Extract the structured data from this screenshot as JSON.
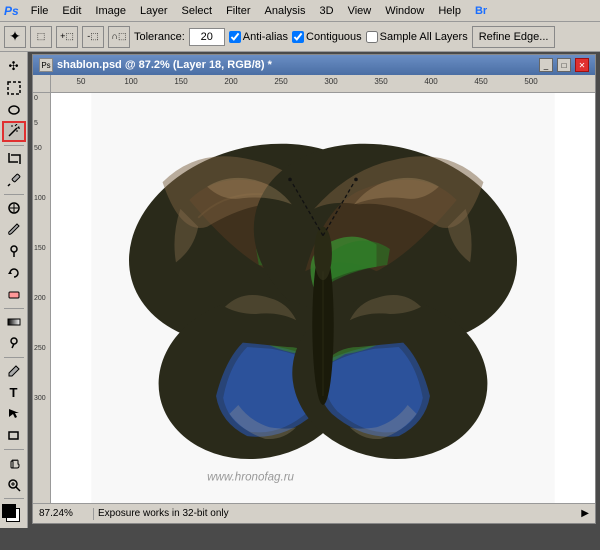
{
  "menubar": {
    "logo": "Ps",
    "items": [
      "File",
      "Edit",
      "Image",
      "Layer",
      "Select",
      "Filter",
      "Analysis",
      "3D",
      "View",
      "Window",
      "Help",
      "Br"
    ]
  },
  "optionsbar": {
    "tolerance_label": "Tolerance:",
    "tolerance_value": "20",
    "antialias_label": "Anti-alias",
    "contiguous_label": "Contiguous",
    "sampleall_label": "Sample All Layers",
    "antialias_checked": true,
    "contiguous_checked": true,
    "sampleall_checked": false,
    "refine_label": "Refine Edge..."
  },
  "document": {
    "icon": "Ps",
    "title": "shablon.psd @ 87.2% (Layer 18, RGB/8) *"
  },
  "ruler": {
    "h_marks": [
      50,
      100,
      150,
      200,
      250,
      300,
      350,
      400,
      450,
      500
    ],
    "v_marks": [
      0,
      5,
      50,
      100,
      150,
      200,
      250,
      300
    ]
  },
  "statusbar": {
    "zoom": "87.24%",
    "status_text": "Exposure works in 32-bit only"
  },
  "watermark": {
    "text": "www.hronofag.ru"
  },
  "tools": [
    {
      "name": "move",
      "icon": "✣",
      "active": false
    },
    {
      "name": "rectangular-marquee",
      "icon": "⬚",
      "active": false
    },
    {
      "name": "lasso",
      "icon": "⌾",
      "active": false
    },
    {
      "name": "magic-wand",
      "icon": "✦",
      "active": true,
      "highlighted": true
    },
    {
      "name": "crop",
      "icon": "✂",
      "active": false
    },
    {
      "name": "eyedropper",
      "icon": "⊘",
      "active": false
    },
    {
      "name": "healing-brush",
      "icon": "✚",
      "active": false
    },
    {
      "name": "brush",
      "icon": "✏",
      "active": false
    },
    {
      "name": "clone-stamp",
      "icon": "⊕",
      "active": false
    },
    {
      "name": "history-brush",
      "icon": "↩",
      "active": false
    },
    {
      "name": "eraser",
      "icon": "⬜",
      "active": false
    },
    {
      "name": "gradient",
      "icon": "▦",
      "active": false
    },
    {
      "name": "dodge",
      "icon": "◯",
      "active": false
    },
    {
      "name": "pen",
      "icon": "✒",
      "active": false
    },
    {
      "name": "type",
      "icon": "T",
      "active": false
    },
    {
      "name": "path-selection",
      "icon": "↖",
      "active": false
    },
    {
      "name": "shape",
      "icon": "▭",
      "active": false
    },
    {
      "name": "zoom",
      "icon": "⌕",
      "active": false
    },
    {
      "name": "hand",
      "icon": "✋",
      "active": false
    }
  ]
}
